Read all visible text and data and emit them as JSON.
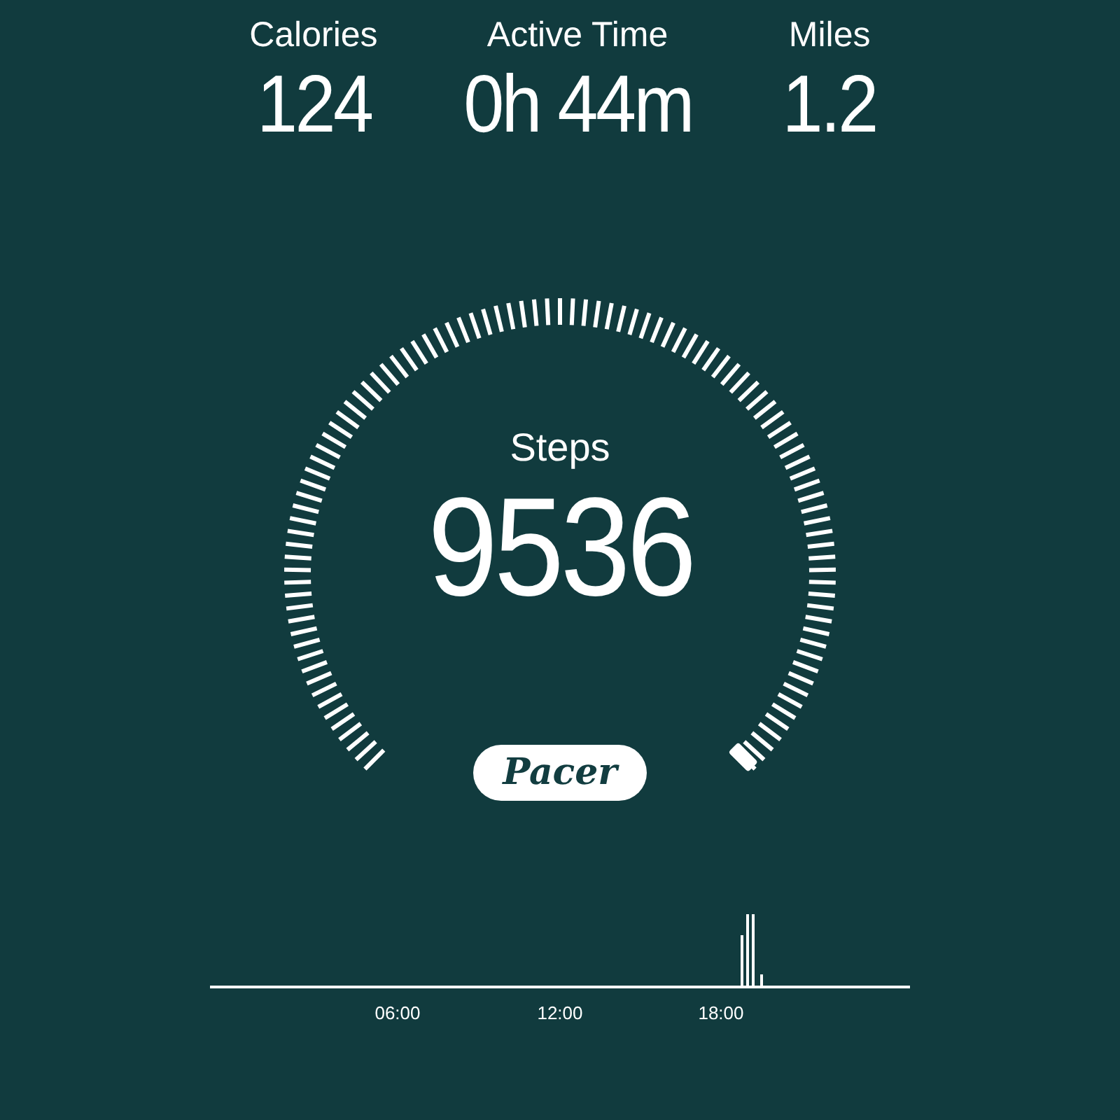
{
  "stats": [
    {
      "label": "Calories",
      "value": "124"
    },
    {
      "label": "Active Time",
      "value": "0h 44m"
    },
    {
      "label": "Miles",
      "value": "1.2"
    }
  ],
  "steps": {
    "label": "Steps",
    "value": "9536"
  },
  "logo": "Pacer",
  "timeline": {
    "labels": [
      "06:00",
      "12:00",
      "18:00"
    ]
  }
}
